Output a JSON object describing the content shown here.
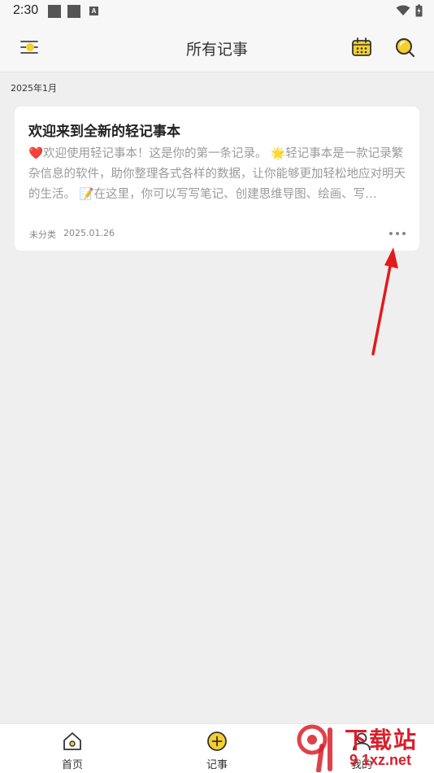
{
  "status_bar": {
    "time": "2:30"
  },
  "header": {
    "title": "所有记事",
    "menu_icon": "menu-sun-icon",
    "calendar_icon": "calendar-icon",
    "search_icon": "search-icon"
  },
  "list": {
    "month": "2025年1月",
    "notes": [
      {
        "title": "欢迎来到全新的轻记事本",
        "body": "❤️欢迎使用轻记事本！这是你的第一条记录。 🌟轻记事本是一款记录繁杂信息的软件，助你整理各式各样的数据，让你能够更加轻松地应对明天的生活。 📝在这里，你可以写写笔记、创建思维导图、绘画、写…",
        "category": "未分类",
        "date": "2025.01.26"
      }
    ]
  },
  "bottom_nav": {
    "items": [
      {
        "label": "首页",
        "icon": "home-icon"
      },
      {
        "label": "记事",
        "icon": "add-circle-icon"
      },
      {
        "label": "我的",
        "icon": "profile-icon"
      }
    ]
  },
  "watermark": {
    "top": "下载站",
    "bottom": "9 1xz.net"
  },
  "colors": {
    "accent": "#f5d02c",
    "background": "#efefef",
    "watermark": "#d9202a",
    "annotation_arrow": "#e21b1b"
  }
}
